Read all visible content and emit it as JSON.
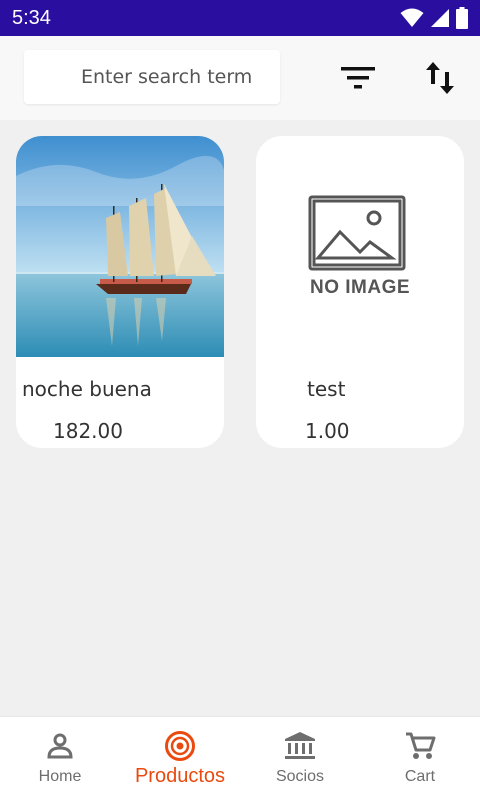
{
  "status_bar": {
    "time": "5:34",
    "icons": [
      "wifi-icon",
      "signal-icon",
      "battery-icon"
    ]
  },
  "search": {
    "placeholder": "Enter search term",
    "value": ""
  },
  "toolbar": {
    "icons": [
      "filter-icon",
      "sort-icon"
    ]
  },
  "products": [
    {
      "name": "noche buena",
      "price": "182.00",
      "image": "sailboat-photo"
    },
    {
      "name": "test",
      "price": "1.00",
      "image": "no-image-placeholder",
      "image_caption": "NO IMAGE"
    }
  ],
  "nav": {
    "items": [
      {
        "label": "Home",
        "icon": "person-icon",
        "active": false
      },
      {
        "label": "Productos",
        "icon": "target-icon",
        "active": true
      },
      {
        "label": "Socios",
        "icon": "bank-icon",
        "active": false
      },
      {
        "label": "Cart",
        "icon": "cart-icon",
        "active": false
      }
    ]
  },
  "colors": {
    "status_bar": "#2a0ea0",
    "accent": "#ea4a10",
    "background": "#f0f0f0",
    "inactive_nav": "#6e6e6e"
  }
}
